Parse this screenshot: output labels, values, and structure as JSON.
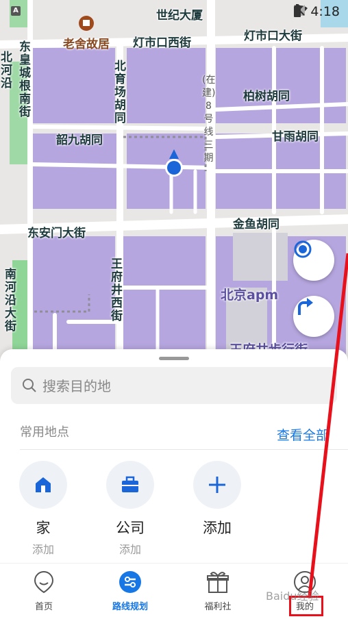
{
  "status_bar": {
    "indicator": "A",
    "time": "4:18"
  },
  "map": {
    "labels": {
      "century_building": "世纪大厦",
      "laoshe": "老舍故居",
      "dengshikou_west": "灯市口西街",
      "dengshikou_ave": "灯市口大街",
      "dhcgn": "东皇城根南街",
      "beiyuchang": "北育场胡同",
      "line8": "(在建)8号线三期",
      "baishu": "柏树胡同",
      "shaojiu": "韶九胡同",
      "ganyu": "甘雨胡同",
      "donganmen": "东安门大街",
      "jinyu": "金鱼胡同",
      "wangfujing_west": "王府井西街",
      "nanheyan": "南河沿大街",
      "beijing_apm": "北京apm",
      "wangfujing_walk": "王府井步行街",
      "bei_left": "北河沿"
    }
  },
  "sheet": {
    "search_placeholder": "搜索目的地",
    "section_title": "常用地点",
    "view_all": "查看全部",
    "places": [
      {
        "name": "家",
        "sub": "添加"
      },
      {
        "name": "公司",
        "sub": "添加"
      },
      {
        "name": "添加",
        "sub": ""
      }
    ]
  },
  "tabs": [
    {
      "label": "首页"
    },
    {
      "label": "路线规划"
    },
    {
      "label": "福利社"
    },
    {
      "label": "我的"
    }
  ],
  "watermark": "Baidu经验",
  "colors": {
    "accent": "#1677e5",
    "district": "#b6a6df",
    "road": "#ffffff",
    "annotation": "#e8101b"
  }
}
